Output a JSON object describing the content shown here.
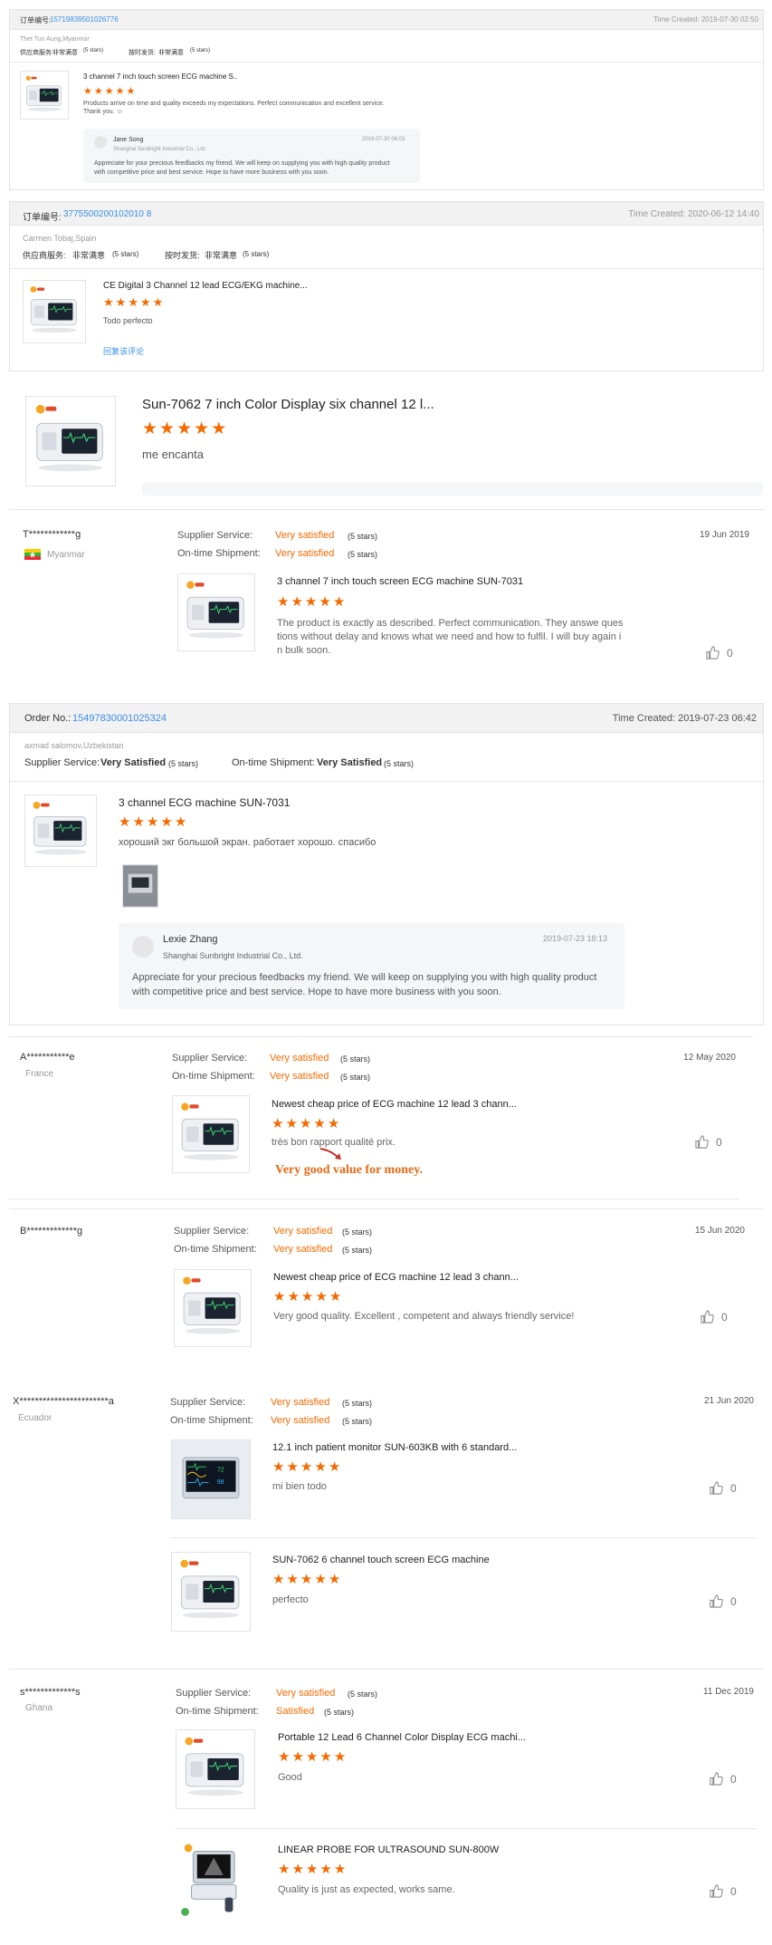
{
  "r1": {
    "order_label": "订单编号:",
    "order_no": "15719839501026776",
    "time": "Time Created: 2019-07-30 02:50",
    "buyer": "Thet Tun Aung,Myanmar",
    "supplier_label": "供应商服务:",
    "supplier_value": "非常满意",
    "supplier_stars": "(5 stars)",
    "shipment_label": "按时发货:",
    "shipment_value": "非常满意",
    "shipment_stars": "(5 stars)",
    "product": "3 channel 7 inch touch screen ECG machine S..",
    "comment": "Products arrive on time and quality exceeds my expectations. Perfect communication and excellent service.",
    "comment2": "Thank you. ☺",
    "reply_name": "Jane Song",
    "reply_company": "Shanghai Sunbright Industrial Co., Ltd.",
    "reply_time": "2019-07-30 06:03",
    "reply_text1": "Appreciate for your precious feedbacks my friend. We will keep on supplying you with high quality product",
    "reply_text2": "with competitive price and best service. Hope to have more business with you soon."
  },
  "r2": {
    "order_label": "订单编号:",
    "order_no": "3775500200102010 8",
    "time": "Time Created: 2020-06-12 14:40",
    "buyer": "Carmen Tobaj,Spain",
    "supplier_label": "供应商服务:",
    "supplier_value": "非常满意",
    "supplier_stars": "(5 stars)",
    "shipment_label": "按时发货:",
    "shipment_value": "非常满意",
    "shipment_stars": "(5 stars)",
    "product": "CE Digital 3 Channel 12 lead ECG/EKG machine...",
    "comment": "Todo perfecto",
    "reply_link": "回复该评论"
  },
  "r3": {
    "product": "Sun-7062 7 inch Color Display six channel 12 l...",
    "comment": "me encanta"
  },
  "r4": {
    "buyer": "T************g",
    "country": "Myanmar",
    "supplier_label": "Supplier Service:",
    "supplier_value": "Very satisfied",
    "supplier_stars": "(5 stars)",
    "shipment_label": "On-time Shipment:",
    "shipment_value": "Very satisfied",
    "shipment_stars": "(5 stars)",
    "date": "19 Jun 2019",
    "product": "3 channel 7 inch touch screen ECG machine SUN-7031",
    "comment1": "The product is exactly as described. Perfect communication. They answe ques",
    "comment2": "tions without delay and knows what we need and how to fulfil. I will buy again i",
    "comment3": "n bulk soon.",
    "likes": "0"
  },
  "r5": {
    "order_label": "Order No.:",
    "order_no": "15497830001025324",
    "time": "Time Created: 2019-07-23 06:42",
    "buyer": "axmad salomov,Uzbekistan",
    "supplier_label": "Supplier Service:",
    "supplier_value": "Very Satisfied",
    "supplier_stars": "(5 stars)",
    "shipment_label": "On-time Shipment:",
    "shipment_value": "Very Satisfied",
    "shipment_stars": "(5 stars)",
    "product": "3 channel ECG machine SUN-7031",
    "comment": "хороший экг большой экран. работает хорошо. спасибо",
    "reply_name": "Lexie Zhang",
    "reply_company": "Shanghai Sunbright Industrial Co., Ltd.",
    "reply_time": "2019-07-23 18:13",
    "reply_text1": "Appreciate for your precious feedbacks my friend. We will keep on supplying you with high quality product",
    "reply_text2": "with competitive price and best service. Hope to have more business with you soon."
  },
  "r6": {
    "buyer": "A***********e",
    "country": "France",
    "supplier_label": "Supplier Service:",
    "supplier_value": "Very satisfied",
    "supplier_stars": "(5 stars)",
    "shipment_label": "On-time Shipment:",
    "shipment_value": "Very satisfied",
    "shipment_stars": "(5 stars)",
    "date": "12 May 2020",
    "product": "Newest cheap price of ECG machine 12 lead 3 chann...",
    "comment": "très bon rapport qualité prix.",
    "annotation": "Very good value for money.",
    "likes": "0"
  },
  "r7": {
    "buyer": "B*************g",
    "supplier_label": "Supplier Service:",
    "supplier_value": "Very satisfied",
    "supplier_stars": "(5 stars)",
    "shipment_label": "On-time Shipment:",
    "shipment_value": "Very satisfied",
    "shipment_stars": "(5 stars)",
    "date": "15 Jun 2020",
    "product": "Newest cheap price of ECG machine 12 lead 3 chann...",
    "comment": "Very good quality. Excellent , competent and always friendly service!",
    "likes": "0"
  },
  "r8": {
    "buyer": "X***********************a",
    "country": "Ecuador",
    "supplier_label": "Supplier Service:",
    "supplier_value": "Very satisfied",
    "supplier_stars": "(5 stars)",
    "shipment_label": "On-time Shipment:",
    "shipment_value": "Very satisfied",
    "shipment_stars": "(5 stars)",
    "date": "21 Jun 2020",
    "product1": "12.1 inch patient monitor SUN-603KB with 6 standard...",
    "comment1": "mi bien todo",
    "likes1": "0",
    "product2": "SUN-7062 6 channel touch screen ECG machine",
    "comment2": "perfecto",
    "likes2": "0"
  },
  "r9": {
    "buyer": "s*************s",
    "country": "Ghana",
    "supplier_label": "Supplier Service:",
    "supplier_value": "Very satisfied",
    "supplier_stars": "(5 stars)",
    "shipment_label": "On-time Shipment:",
    "shipment_value": "Satisfied",
    "shipment_stars": "(5 stars)",
    "date": "11 Dec 2019",
    "product1": "Portable 12 Lead 6 Channel Color Display ECG machi...",
    "comment1": "Good",
    "likes1": "0",
    "product2": "LINEAR PROBE FOR ULTRASOUND SUN-800W",
    "comment2": "Quality is just as expected, works same.",
    "likes2": "0"
  },
  "colors": {
    "accent_orange": "#f56a00",
    "link_blue": "#3a8ee6",
    "header_gray": "#f2f2f2"
  },
  "icons": [
    "star-icon",
    "thumbs-up-icon",
    "flag-myanmar-icon",
    "ecg-machine-image",
    "patient-monitor-image",
    "ultrasound-probe-image"
  ]
}
